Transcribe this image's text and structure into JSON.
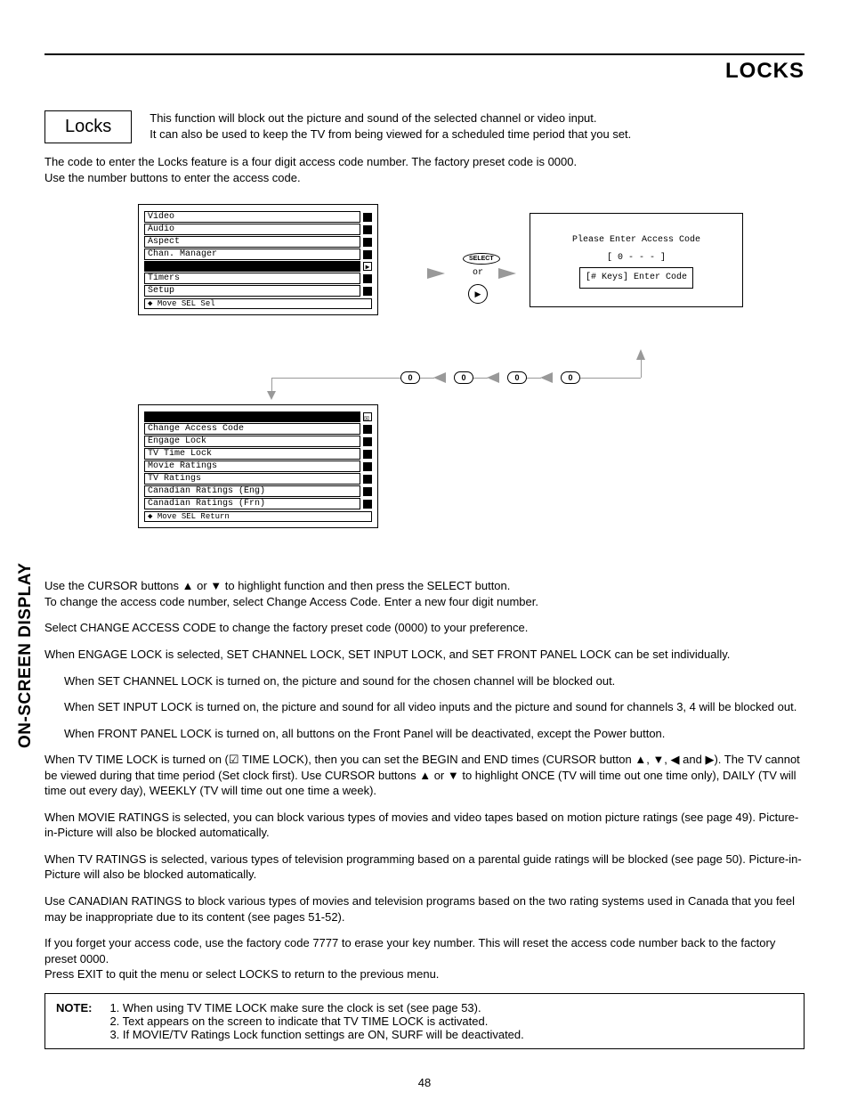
{
  "header": {
    "title": "LOCKS"
  },
  "locks_box": "Locks",
  "intro1": "This function will block out the picture and sound of the selected channel or video input.",
  "intro2": "It can also be used to keep the TV from being viewed for a scheduled time period that you set.",
  "access1": "The code to enter the Locks feature is a four digit access code number.  The factory preset code is 0000.",
  "access2": "Use the number buttons to enter the access code.",
  "menu1": {
    "items": [
      "Video",
      "Audio",
      "Aspect",
      "Chan. Manager",
      "",
      "Timers",
      "Setup"
    ],
    "foot": "◆ Move  SEL  Sel"
  },
  "select_label": "SELECT",
  "or_label": "or",
  "code_box": {
    "l1": "Please Enter Access Code",
    "l2": "[ 0 - - - ]",
    "l3": "[# Keys] Enter Code"
  },
  "zero": "0",
  "menu2": {
    "items": [
      "Change Access Code",
      "Engage Lock",
      "TV Time Lock",
      "Movie Ratings",
      "TV Ratings",
      "Canadian Ratings (Eng)",
      "Canadian Ratings (Frn)"
    ],
    "foot": "◆ Move  SEL  Return"
  },
  "p1": "Use the CURSOR buttons ▲ or ▼ to highlight function and then press the SELECT button.",
  "p2": "To change the access code number, select Change Access Code.  Enter a new four digit number.",
  "p3": "Select CHANGE ACCESS CODE to change the factory preset code (0000) to your preference.",
  "p4": "When ENGAGE LOCK is selected, SET CHANNEL LOCK, SET INPUT LOCK, and SET FRONT PANEL LOCK can be set individually.",
  "p5": "When SET CHANNEL LOCK is turned on, the picture and sound for the chosen channel will be blocked out.",
  "p6": "When SET INPUT LOCK is turned on, the picture and sound for all video inputs and the picture and sound for channels 3, 4 will be blocked out.",
  "p7": "When FRONT PANEL LOCK is turned on, all buttons on the Front Panel will be deactivated, except the Power button.",
  "p8": "When TV TIME LOCK is turned on (☑ TIME LOCK), then you can set the BEGIN and END times (CURSOR button ▲, ▼, ◀ and ▶). The TV cannot be viewed during that time period (Set clock first). Use CURSOR buttons ▲ or ▼ to highlight ONCE (TV will time out one time only), DAILY (TV will time out every day), WEEKLY (TV will time out one time a week).",
  "p9": "When MOVIE RATINGS is selected, you can block various types of movies and video tapes based on motion picture ratings (see page 49). Picture-in-Picture will also be blocked automatically.",
  "p10": "When TV RATINGS is selected, various types of television programming based on a parental guide ratings will be blocked (see page 50). Picture-in-Picture will also be blocked automatically.",
  "p11": "Use CANADIAN RATINGS to block various types of movies and television programs based on the two rating systems used in Canada that you feel may be inappropriate due to its content (see pages 51-52).",
  "p12": "If you forget your access code, use the factory code 7777 to erase your key number. This will reset the access code number back to the factory preset 0000.",
  "p13": "Press EXIT to quit the menu or select LOCKS to return to the previous menu.",
  "note_label": "NOTE:",
  "note1": "1. When using TV TIME LOCK make sure the clock is set (see page 53).",
  "note2": "2. Text appears on the screen to indicate that TV TIME LOCK is activated.",
  "note3": "3. If MOVIE/TV Ratings Lock function settings are ON, SURF will be deactivated.",
  "side": "ON-SCREEN DISPLAY",
  "page": "48"
}
